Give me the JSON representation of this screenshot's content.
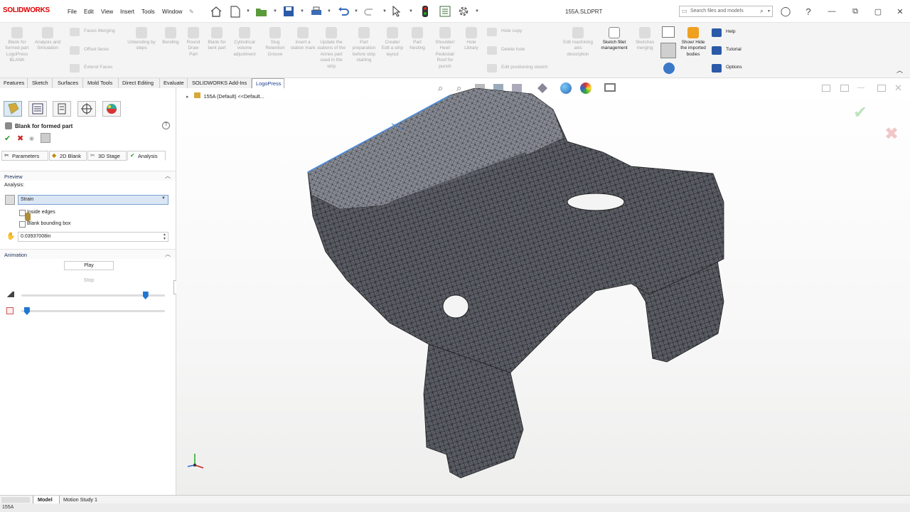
{
  "app": {
    "logo_text": "SOLIDWORKS",
    "document_title": "155A.SLDPRT"
  },
  "menu": [
    "File",
    "Edit",
    "View",
    "Insert",
    "Tools",
    "Window"
  ],
  "search": {
    "placeholder": "Search files and models"
  },
  "ribbon": {
    "groups": [
      {
        "label": "Blank for formed part LogoPress BLANK",
        "enabled": false
      },
      {
        "label": "Analysis and Simulation",
        "enabled": false
      },
      {
        "label": "Faces Merging",
        "enabled": false
      },
      {
        "label": "Offset faces",
        "enabled": false
      },
      {
        "label": "Extend Faces",
        "enabled": false
      },
      {
        "label": "Unbending by steps",
        "enabled": false
      },
      {
        "label": "Bending",
        "enabled": false
      },
      {
        "label": "Round Draw Part",
        "enabled": false
      },
      {
        "label": "Blank for bent part",
        "enabled": false
      },
      {
        "label": "Cylindrical volume adjustment",
        "enabled": false
      },
      {
        "label": "Slug Retention Groove",
        "enabled": false
      },
      {
        "label": "Insert a station mark",
        "enabled": false
      },
      {
        "label": "Update the stations of the Annex part used in the strip",
        "enabled": false
      },
      {
        "label": "Part preparation before strip starting",
        "enabled": false
      },
      {
        "label": "Create/ Edit a strip layout",
        "enabled": false
      },
      {
        "label": "Part Nesting",
        "enabled": false
      },
      {
        "label": "Shoulder/ Heel/ Pedestal/ Roof for punch",
        "enabled": false
      },
      {
        "label": "Hole Library",
        "enabled": false
      },
      {
        "label": "Hole copy",
        "enabled": false
      },
      {
        "label": "Delete hole",
        "enabled": false
      },
      {
        "label": "Edit positioning sketch",
        "enabled": false
      },
      {
        "label": "Edit machining axis description",
        "enabled": false
      },
      {
        "label": "Sketch fillet management",
        "enabled": true
      },
      {
        "label": "Sketches merging",
        "enabled": false
      },
      {
        "label": "Show/ Hide the imported bodies",
        "enabled": true
      },
      {
        "label": "Help",
        "enabled": true
      },
      {
        "label": "Tutorial",
        "enabled": true
      },
      {
        "label": "Options",
        "enabled": true
      }
    ]
  },
  "command_tabs": [
    "Features",
    "Sketch",
    "Surfaces",
    "Mold Tools",
    "Direct Editing",
    "Evaluate",
    "SOLIDWORKS Add-Ins",
    "LogoPress"
  ],
  "active_command_tab": "LogoPress",
  "property_manager": {
    "title": "Blank for formed part",
    "subtabs": [
      "Parameters",
      "2D Blank",
      "3D Stage",
      "Analysis"
    ],
    "active_subtab": "Analysis",
    "preview_section": "Preview",
    "analysis_label": "Analysis:",
    "analysis_value": "Strain",
    "inside_edges_label": "Inside edges",
    "inside_edges_checked": false,
    "blank_bbox_label": "Blank bounding box",
    "blank_bbox_checked": false,
    "thickness_value": "0.03937008in",
    "animation_section": "Animation",
    "play_label": "Play",
    "stop_label": "Stop",
    "slider1_level": 0.88,
    "slider2_level": 0.02
  },
  "feature_tree": {
    "root_label": "155A (Default) <<Default..."
  },
  "bottom_tabs": [
    "Model",
    "Motion Study 1"
  ],
  "status_text": "155A",
  "colors": {
    "accent": "#1a3d8f",
    "brand": "#d00000",
    "mesh": "#55585f"
  }
}
